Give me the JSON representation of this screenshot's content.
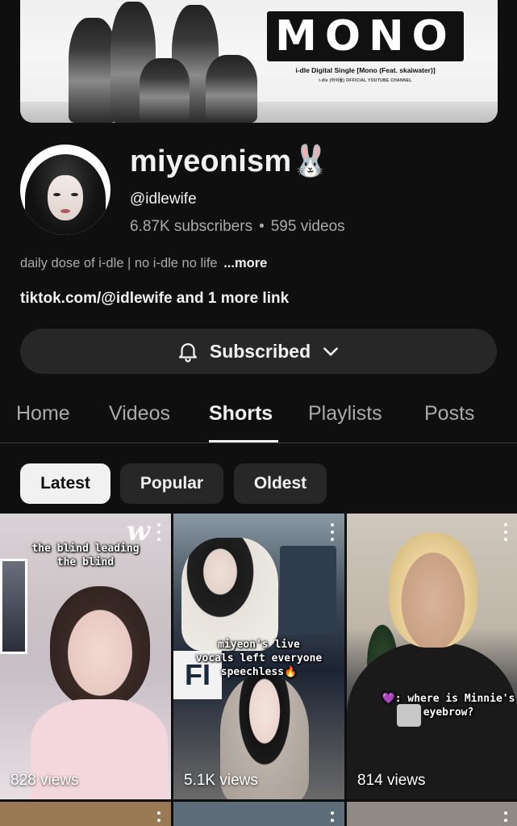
{
  "banner": {
    "title": "MONO",
    "subtitle": "i-dle Digital Single [Mono (Feat. skaiwater)]",
    "caption": "i-dle (아이들) OFFICIAL YOUTUBE CHANNEL"
  },
  "channel": {
    "name": "miyeonism🐰",
    "handle": "@idlewife",
    "subscribers": "6.87K subscribers",
    "separator": "•",
    "videos": "595 videos",
    "description": "daily dose of i-dle | no i-dle no life",
    "more_label": "...more",
    "link": "tiktok.com/@idlewife and 1 more link"
  },
  "subscribe": {
    "label": "Subscribed",
    "icon": "bell-icon",
    "dropdown_icon": "chevron-down-icon"
  },
  "tabs": [
    {
      "label": "Home"
    },
    {
      "label": "Videos"
    },
    {
      "label": "Shorts",
      "active": true
    },
    {
      "label": "Playlists"
    },
    {
      "label": "Posts"
    }
  ],
  "chips": [
    {
      "label": "Latest",
      "active": true
    },
    {
      "label": "Popular"
    },
    {
      "label": "Oldest"
    }
  ],
  "shorts": [
    {
      "caption": "the blind leading\nthe blind",
      "views": "828 views"
    },
    {
      "caption": "miyeon's live\nvocals left everyone\nspeechless🔥",
      "views": "5.1K views"
    },
    {
      "caption": "💜: where is Minnie's\neyebrow?",
      "views": "814 views"
    }
  ],
  "colors": {
    "background": "#0f0f0f",
    "surface": "#272727",
    "text_primary": "#f1f1f1",
    "text_secondary": "#aaaaaa"
  }
}
